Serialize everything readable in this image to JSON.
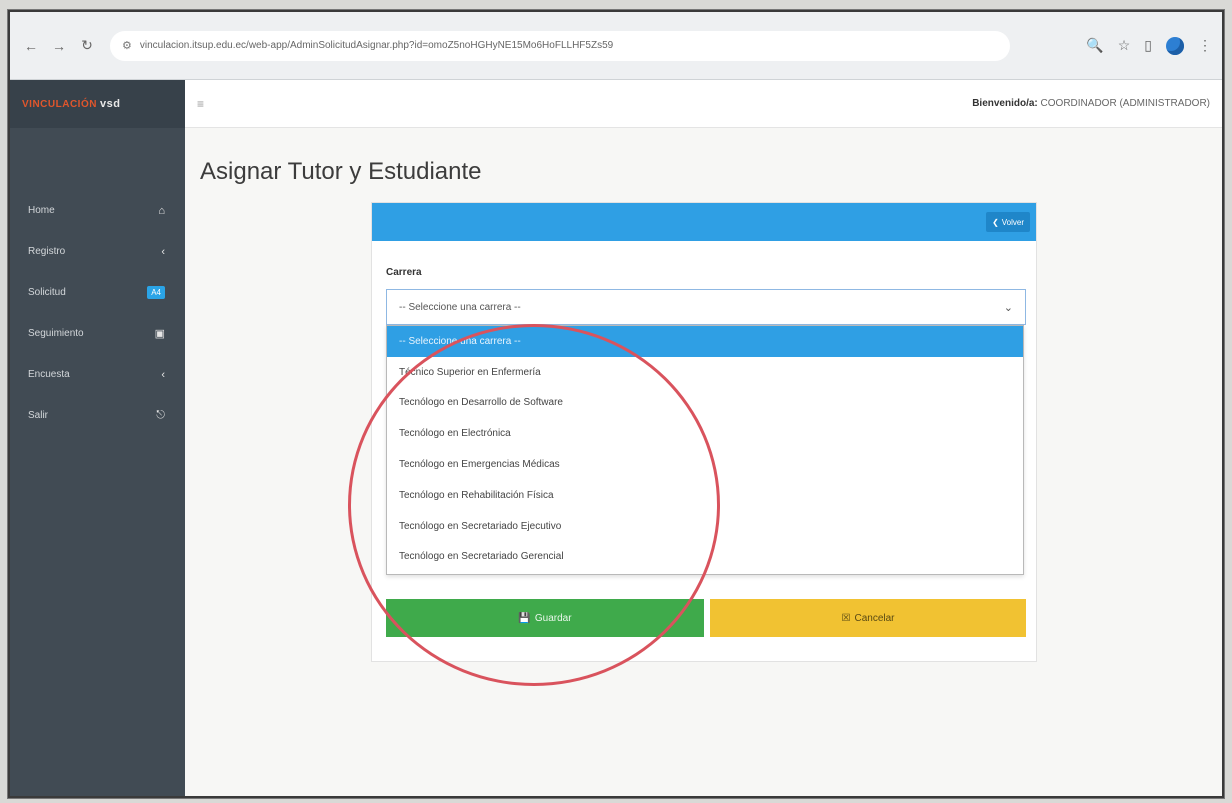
{
  "browser": {
    "url": "vinculacion.itsup.edu.ec/web-app/AdminSolicitudAsignar.php?id=omoZ5noHGHyNE15Mo6HoFLLHF5Zs59",
    "icons": [
      "back-arrow-icon",
      "forward-arrow-icon",
      "reload-icon",
      "site-settings-icon",
      "zoom-icon",
      "star-icon",
      "sidepanel-icon",
      "profile-icon",
      "more-icon"
    ]
  },
  "sidebar": {
    "brand_main": "VINCULACIÓN",
    "brand_suffix": "vsd",
    "items": [
      {
        "label": "Home",
        "icon": "home-icon"
      },
      {
        "label": "Registro",
        "icon": "chevron-left-icon"
      },
      {
        "label": "Solicitud",
        "icon": "badge",
        "badge": "A4"
      },
      {
        "label": "Seguimiento",
        "icon": "clipboard-icon"
      },
      {
        "label": "Encuesta",
        "icon": "chevron-left-icon"
      },
      {
        "label": "Salir",
        "icon": "logout-icon"
      }
    ]
  },
  "topbar": {
    "welcome_prefix": "Bienvenido/a:",
    "user": "COORDINADOR (ADMINISTRADOR)"
  },
  "page": {
    "title": "Asignar Tutor y Estudiante"
  },
  "card": {
    "back_label": "Volver",
    "field_label": "Carrera",
    "select_value": "-- Seleccione una carrera --",
    "options": [
      "-- Seleccione una carrera --",
      "Técnico Superior en Enfermería",
      "Tecnólogo en Desarrollo de Software",
      "Tecnólogo en Electrónica",
      "Tecnólogo en Emergencias Médicas",
      "Tecnólogo en Rehabilitación Física",
      "Tecnólogo en Secretariado Ejecutivo",
      "Tecnólogo en Secretariado Gerencial"
    ],
    "save_label": "Guardar",
    "cancel_label": "Cancelar"
  },
  "colors": {
    "sidebar": "#414b54",
    "primary": "#2f9fe4",
    "success": "#3faa4b",
    "warning": "#f1c232",
    "annotation": "#d9535d"
  }
}
